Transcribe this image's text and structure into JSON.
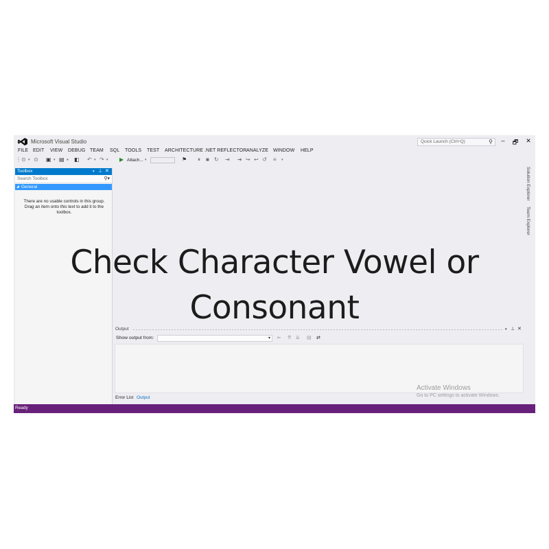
{
  "window": {
    "app_title": "Microsoft Visual Studio",
    "quick_launch_placeholder": "Quick Launch (Ctrl+Q)",
    "controls": [
      "–",
      "🗗",
      "✕"
    ]
  },
  "menu": {
    "items": [
      "FILE",
      "EDIT",
      "VIEW",
      "DEBUG",
      "TEAM",
      "SQL",
      "TOOLS",
      "TEST",
      "ARCHITECTURE",
      ".NET REFLECTOR",
      "ANALYZE",
      "WINDOW",
      "HELP"
    ]
  },
  "toolbar": {
    "attach_label": "Attach..."
  },
  "toolbox": {
    "title": "Toolbox",
    "search_placeholder": "Search Toolbox",
    "group_label": "General",
    "empty_message": "There are no usable controls in this group. Drag an item onto this text to add it to the toolbox."
  },
  "side_tabs": [
    "Solution Explorer",
    "Team Explorer"
  ],
  "output": {
    "title": "Output",
    "show_output_from_label": "Show output from:",
    "show_output_from_value": "",
    "tabs": [
      "Error List",
      "Output"
    ],
    "active_tab": "Output"
  },
  "activation": {
    "line1": "Activate Windows",
    "line2": "Go to PC settings to activate Windows."
  },
  "status": {
    "text": "Ready"
  },
  "overlay": {
    "line1": "Check Character Vowel or",
    "line2": "Consonant"
  },
  "colors": {
    "accent": "#007acc",
    "status_bar": "#68217a",
    "selected_group": "#3399ff"
  }
}
